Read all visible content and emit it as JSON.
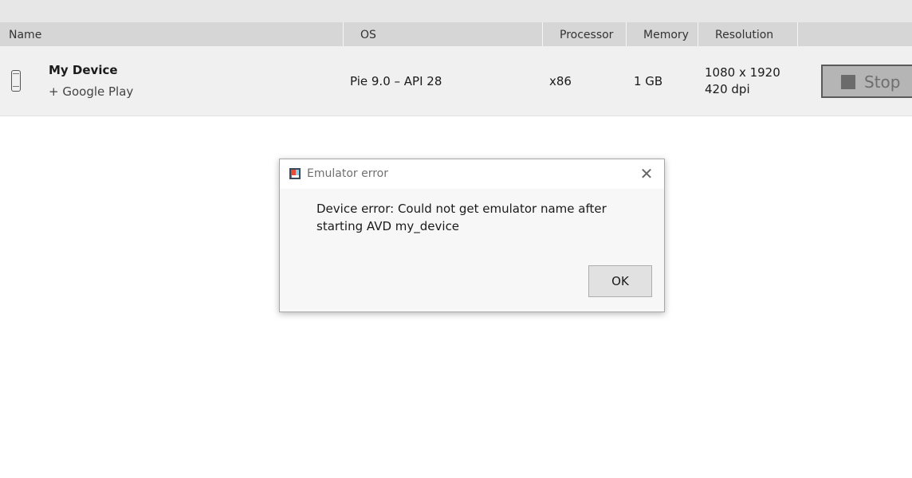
{
  "table": {
    "headers": {
      "name": "Name",
      "os": "OS",
      "processor": "Processor",
      "memory": "Memory",
      "resolution": "Resolution"
    },
    "rows": [
      {
        "icon": "phone-icon",
        "name": "My Device",
        "subtitle": "+ Google Play",
        "os": "Pie 9.0 – API 28",
        "processor": "x86",
        "memory": "1 GB",
        "resolution": "1080 x 1920",
        "density": "420 dpi",
        "action_label": "Stop",
        "action_icon": "stop-icon"
      }
    ]
  },
  "dialog": {
    "title": "Emulator error",
    "title_icon": "emulator-app-icon",
    "close_icon": "close-icon",
    "message": "Device error: Could not get emulator name after starting AVD my_device",
    "ok_label": "OK"
  },
  "colors": {
    "header_bg": "#d6d6d6",
    "row_bg": "#f0f0f0",
    "dialog_bg": "#f7f7f7",
    "button_bg": "#e1e1e1"
  }
}
